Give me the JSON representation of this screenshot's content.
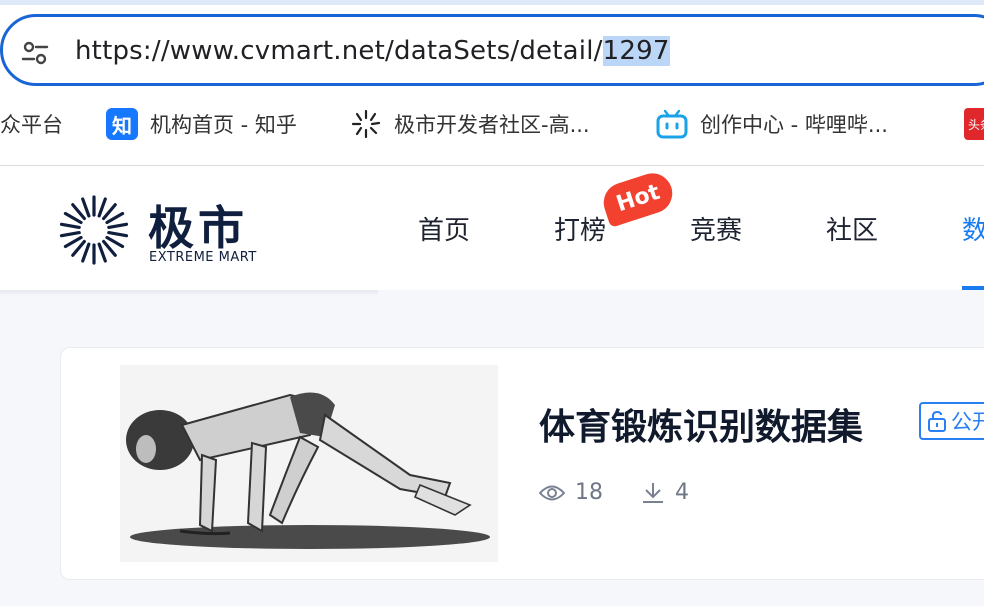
{
  "browser": {
    "url_main": "https://www.cvmart.net/dataSets/detail/",
    "url_selected": "1297",
    "bookmarks": [
      {
        "label": "众平台"
      },
      {
        "label": "机构首页 - 知乎",
        "icon_text": "知"
      },
      {
        "label": "极市开发者社区-高..."
      },
      {
        "label": "创作中心 - 哔哩哔..."
      },
      {
        "icon_text": "头条"
      }
    ]
  },
  "site": {
    "logo_text": "极市",
    "logo_sub": "EXTREME MART",
    "nav": [
      {
        "label": "首页"
      },
      {
        "label": "打榜"
      },
      {
        "label": "竞赛"
      },
      {
        "label": "社区"
      },
      {
        "label": "数"
      }
    ],
    "hot_badge": "Hot",
    "accent_color": "#1a7bf0"
  },
  "dataset": {
    "title": "体育锻炼识别数据集",
    "tag": "公开",
    "views": "18",
    "downloads": "4"
  }
}
